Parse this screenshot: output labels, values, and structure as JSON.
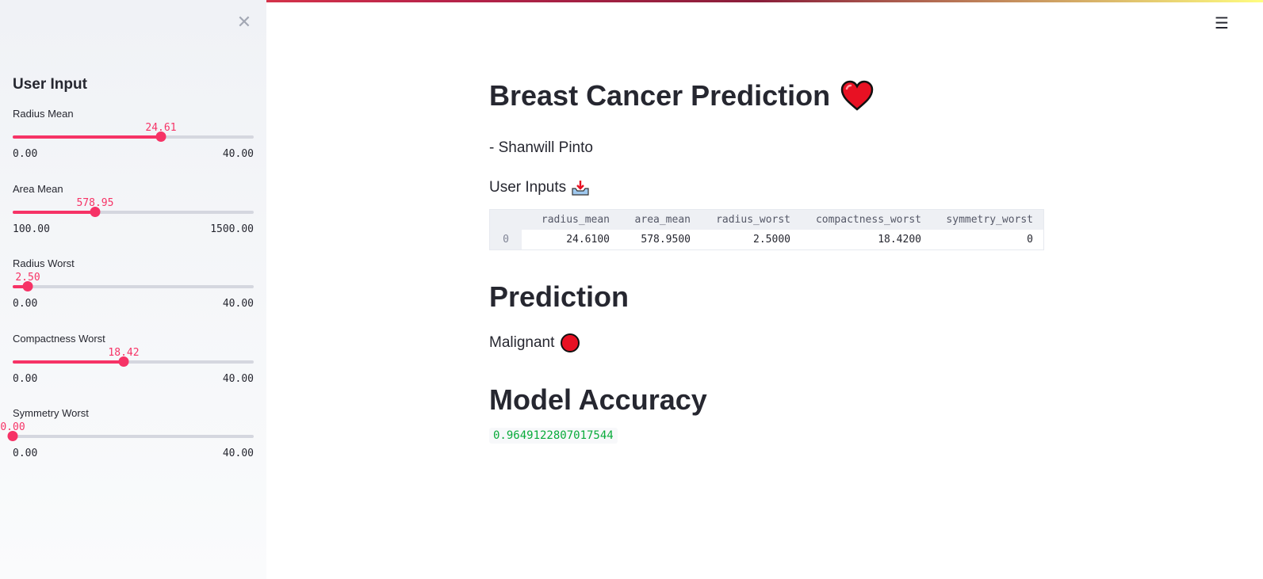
{
  "header": {
    "accent_gradient": [
      "#ff4b4b",
      "#fffd80"
    ],
    "menu_icon": "hamburger-icon"
  },
  "sidebar": {
    "close_icon": "close-icon",
    "title": "User Input",
    "sliders": [
      {
        "label": "Radius Mean",
        "value": "24.61",
        "min": "0.00",
        "max": "40.00",
        "fraction": 0.615
      },
      {
        "label": "Area Mean",
        "value": "578.95",
        "min": "100.00",
        "max": "1500.00",
        "fraction": 0.342
      },
      {
        "label": "Radius Worst",
        "value": "2.50",
        "min": "0.00",
        "max": "40.00",
        "fraction": 0.0625
      },
      {
        "label": "Compactness Worst",
        "value": "18.42",
        "min": "0.00",
        "max": "40.00",
        "fraction": 0.4605
      },
      {
        "label": "Symmetry Worst",
        "value": "0.00",
        "min": "0.00",
        "max": "40.00",
        "fraction": 0.0
      }
    ]
  },
  "main": {
    "title": "Breast Cancer Prediction",
    "title_icon": "heart-icon",
    "author": "- Shanwill Pinto",
    "inputs_heading": "User Inputs",
    "inputs_icon": "inbox-tray-icon",
    "table": {
      "columns": [
        "radius_mean",
        "area_mean",
        "radius_worst",
        "compactness_worst",
        "symmetry_worst"
      ],
      "rows": [
        {
          "index": "0",
          "cells": [
            "24.6100",
            "578.9500",
            "2.5000",
            "18.4200",
            "0"
          ]
        }
      ]
    },
    "prediction_heading": "Prediction",
    "prediction_result": "Malignant",
    "prediction_icon": "red-circle-icon",
    "accuracy_heading": "Model Accuracy",
    "accuracy_value": "0.9649122807017544"
  },
  "colors": {
    "accent": "#f63366",
    "success": "#09ab3b",
    "text": "#262730"
  }
}
